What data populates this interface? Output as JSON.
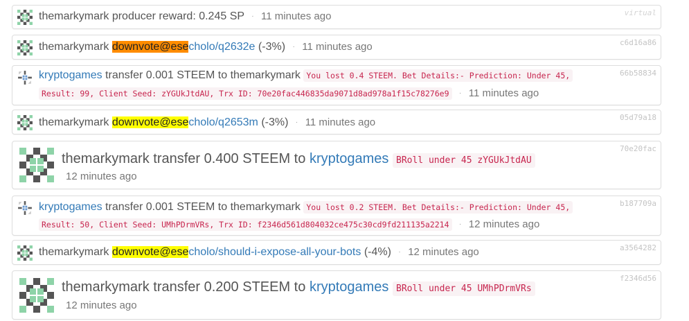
{
  "rows": [
    {
      "id": "virtual",
      "user": "themarkymark",
      "action": "producer reward: 0.245 SP",
      "time": "11 minutes ago"
    },
    {
      "id": "c6d16a86",
      "user": "themarkymark",
      "vote_label": "downvote",
      "vote_color": "#ff8c00",
      "link_user": "@ese",
      "link_rest": "cholo/q2632e",
      "weight": "(-3%)",
      "time": "11 minutes ago"
    },
    {
      "id": "66b58834",
      "from": "kryptogames",
      "action": "transfer 0.001 STEEM to themarkymark",
      "memo_line1": "You lost 0.4 STEEM. Bet Details:- Prediction: Under 45,",
      "memo_line2": "Result: 99, Client Seed: zYGUkJtdAU, Trx ID: 70e20fac446835da9071d8ad978a1f15c78276e9",
      "time": "11 minutes ago"
    },
    {
      "id": "05d79a18",
      "user": "themarkymark",
      "vote_label": "downvote",
      "vote_color": "#ffff00",
      "link_user": "@ese",
      "link_rest": "cholo/q2653m",
      "weight": "(-3%)",
      "time": "11 minutes ago"
    },
    {
      "id": "70e20fac",
      "user": "themarkymark",
      "action": "transfer 0.400 STEEM to",
      "to": "kryptogames",
      "memo": "BRoll under 45 zYGUkJtdAU",
      "time": "12 minutes ago"
    },
    {
      "id": "b187709a",
      "from": "kryptogames",
      "action": "transfer 0.001 STEEM to themarkymark",
      "memo_line1": "You lost 0.2 STEEM. Bet Details:- Prediction: Under 45,",
      "memo_line2": "Result: 50, Client Seed: UMhPDrmVRs, Trx ID: f2346d561d804032ce475c30cd9fd211135a2214",
      "time": "12 minutes ago"
    },
    {
      "id": "a3564282",
      "user": "themarkymark",
      "vote_label": "downvote",
      "vote_color": "#ffff00",
      "link_user": "@ese",
      "link_rest": "cholo/should-i-expose-all-your-bots",
      "weight": "(-4%)",
      "time": "12 minutes ago"
    },
    {
      "id": "f2346d56",
      "user": "themarkymark",
      "action": "transfer 0.200 STEEM to",
      "to": "kryptogames",
      "memo": "BRoll under 45 UMhPDrmVRs",
      "time": "12 minutes ago"
    }
  ],
  "icons": {
    "themarkymark": "identicon-green-icon",
    "kryptogames": "identicon-blue-icon"
  },
  "separator": "·",
  "colors": {
    "link": "#337ab7",
    "memo_text": "#c7254e",
    "memo_bg": "#f9f2f4",
    "border": "#dddddd"
  }
}
